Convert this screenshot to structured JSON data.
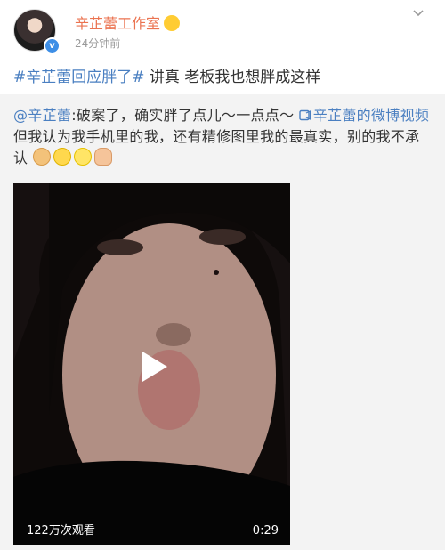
{
  "post": {
    "author": "辛芷蕾工作室",
    "time": "24分钟前",
    "topic": "#辛芷蕾回应胖了#",
    "text": " 讲真 老板我也想胖成这样"
  },
  "repost": {
    "mention": "@辛芷蕾",
    "text_1": ":破案了，确实胖了点儿～一点点～ ",
    "video_link_icon": "video-link-icon",
    "video_link": "辛芷蕾的微博视频",
    "text_2": " 但我认为我手机里的我，还有精修图里我的最真实，别的我不承认",
    "emojis": [
      "dog-emoji",
      "laugh-cry-emoji",
      "grin-emoji",
      "thumbs-up-emoji"
    ]
  },
  "video": {
    "views": "122万次观看",
    "duration": "0:29"
  },
  "colors": {
    "author": "#eb7350",
    "link": "#4a7fc1",
    "repost_bg": "#f3f3f3"
  }
}
